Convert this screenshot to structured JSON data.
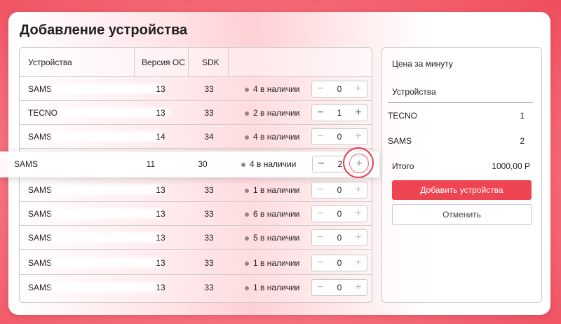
{
  "page_title": "Добавление устройства",
  "table": {
    "headers": {
      "device": "Устройства",
      "os_version": "Версия ОС",
      "sdk": "SDK"
    },
    "rows": [
      {
        "name": "SAMS",
        "os": "13",
        "sdk": "33",
        "availability": "4 в наличии",
        "qty": "0"
      },
      {
        "name": "TECNO",
        "os": "13",
        "sdk": "33",
        "availability": "2 в наличии",
        "qty": "1"
      },
      {
        "name": "SAMS",
        "os": "14",
        "sdk": "34",
        "availability": "4 в наличии",
        "qty": "0"
      },
      {
        "name": "SAMS",
        "os": "13",
        "sdk": "33",
        "availability": "1 в наличии",
        "qty": "0"
      },
      {
        "name": "SAMS",
        "os": "13",
        "sdk": "33",
        "availability": "6 в наличии",
        "qty": "0"
      },
      {
        "name": "SAMS",
        "os": "13",
        "sdk": "33",
        "availability": "5 в наличии",
        "qty": "0"
      },
      {
        "name": "SAMS",
        "os": "13",
        "sdk": "33",
        "availability": "1 в наличии",
        "qty": "0"
      },
      {
        "name": "SAMS",
        "os": "13",
        "sdk": "33",
        "availability": "1 в наличии",
        "qty": "0"
      }
    ],
    "highlighted_row": {
      "name": "SAMS",
      "os": "11",
      "sdk": "30",
      "availability": "4 в наличии",
      "qty": "2"
    },
    "minus_glyph": "−",
    "plus_glyph": "+"
  },
  "summary": {
    "title": "Цена за минуту",
    "subtitle": "Устройства",
    "items": [
      {
        "name": "TECNO",
        "count": "1"
      },
      {
        "name": "SAMS",
        "count": "2"
      }
    ],
    "total_label": "Итого",
    "total_value": "1000,00 Р",
    "add_button": "Добавить устройства",
    "cancel_button": "Отменить"
  },
  "colors": {
    "accent": "#ef4452",
    "background": "#ee4d5c"
  }
}
